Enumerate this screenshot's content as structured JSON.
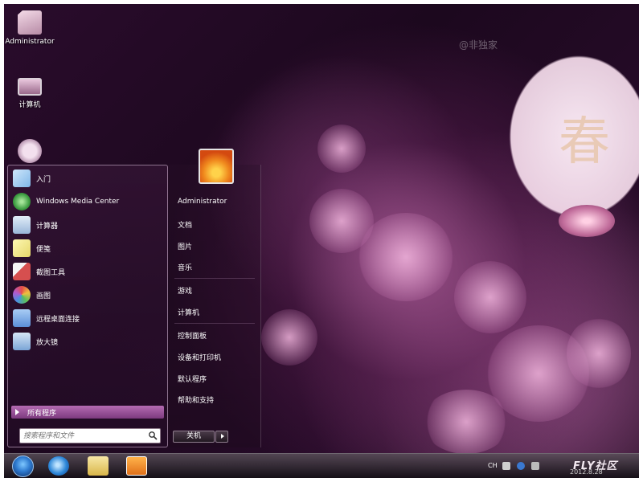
{
  "desktop": {
    "icons": [
      {
        "label": "Administrator",
        "icon": "user-folder-icon"
      },
      {
        "label": "计算机",
        "icon": "computer-icon"
      },
      {
        "label": "",
        "icon": "clock-gadget-icon"
      }
    ],
    "watermark": "@非独家",
    "lantern_text": "春"
  },
  "start_menu": {
    "programs": [
      {
        "label": "入门",
        "icon": "getting-started-icon",
        "color": "#7fb7e8"
      },
      {
        "label": "Windows Media Center",
        "icon": "media-center-icon",
        "color": "#3f9e43"
      },
      {
        "label": "计算器",
        "icon": "calculator-icon",
        "color": "#9ab6d9"
      },
      {
        "label": "便笺",
        "icon": "sticky-notes-icon",
        "color": "#e6d86a"
      },
      {
        "label": "截图工具",
        "icon": "snipping-tool-icon",
        "color": "#d64f4f"
      },
      {
        "label": "画图",
        "icon": "paint-icon",
        "color": "#6fa6e0"
      },
      {
        "label": "远程桌面连接",
        "icon": "remote-desktop-icon",
        "color": "#5b8fd8"
      },
      {
        "label": "放大镜",
        "icon": "magnifier-icon",
        "color": "#7aa4d6"
      }
    ],
    "all_programs_label": "所有程序",
    "search_placeholder": "搜索程序和文件",
    "user_name": "Administrator",
    "right_items": [
      {
        "label": "文档"
      },
      {
        "label": "图片"
      },
      {
        "label": "音乐"
      },
      {
        "label": "游戏"
      },
      {
        "label": "计算机"
      },
      {
        "label": "控制面板"
      },
      {
        "label": "设备和打印机"
      },
      {
        "label": "默认程序"
      },
      {
        "label": "帮助和支持"
      }
    ],
    "shutdown_label": "关机"
  },
  "taskbar": {
    "apps": [
      {
        "icon": "internet-explorer-icon"
      },
      {
        "icon": "explorer-folder-icon"
      },
      {
        "icon": "media-player-icon"
      }
    ],
    "tray": {
      "language": "CH"
    }
  },
  "branding": {
    "logo_text": "FLY社区",
    "logo_sub": "2012.8.28"
  }
}
